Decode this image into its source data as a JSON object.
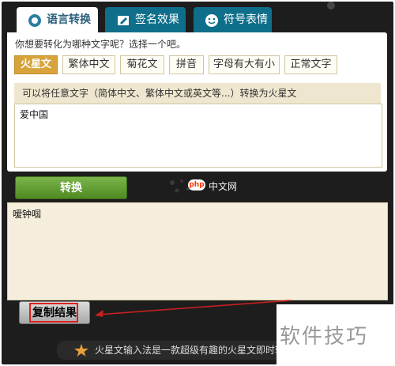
{
  "tabs": [
    {
      "label": "语言转换",
      "active": true,
      "icon": "language-icon"
    },
    {
      "label": "签名效果",
      "active": false,
      "icon": "pencil-icon"
    },
    {
      "label": "符号表情",
      "active": false,
      "icon": "smile-icon"
    }
  ],
  "converter": {
    "question": "你想要转化为哪种文字呢？选择一个吧。",
    "types": [
      {
        "label": "火星文",
        "selected": true
      },
      {
        "label": "繁体中文",
        "selected": false
      },
      {
        "label": "菊花文",
        "selected": false
      },
      {
        "label": "拼音",
        "selected": false
      },
      {
        "label": "字母有大有小",
        "selected": false
      },
      {
        "label": "正常文字",
        "selected": false
      }
    ],
    "hint": "可以将任意文字（简体中文、繁体中文或英文等...）转换为火星文",
    "input_value": "爱中国",
    "convert_label": "转换",
    "output_value": "嗳钟啯",
    "copy_label": "复制结果"
  },
  "branding": {
    "logo_text": "php",
    "site_text": "中文网"
  },
  "watermark": {
    "text": "软件技巧"
  },
  "footer": {
    "text": "火星文输入法是一款超级有趣的火星文即时转换"
  }
}
